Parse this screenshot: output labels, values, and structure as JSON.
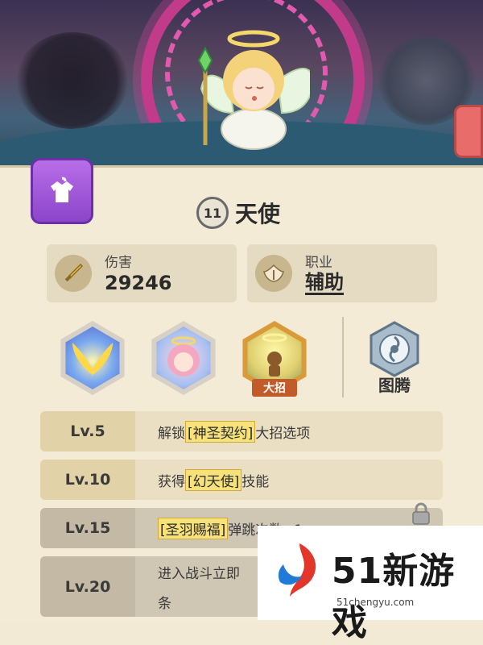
{
  "hero": {
    "level": "11",
    "name": "天使"
  },
  "stats": {
    "damage_label": "伤害",
    "damage_value": "29246",
    "class_label": "职业",
    "class_value": "辅助"
  },
  "skills": {
    "ultimate_tag": "大招",
    "totem_label": "图腾"
  },
  "level_rewards": [
    {
      "level": "Lv.5",
      "prefix": "解锁",
      "highlight": "[神圣契约]",
      "suffix": "大招选项",
      "locked": false
    },
    {
      "level": "Lv.10",
      "prefix": "获得",
      "highlight": "[幻天使]",
      "suffix": "技能",
      "locked": false
    },
    {
      "level": "Lv.15",
      "prefix": "",
      "highlight": "[圣羽赐福]",
      "suffix": "弹跳次数+1",
      "locked": true
    },
    {
      "level": "Lv.20",
      "prefix": "进入战斗立即",
      "highlight": "",
      "suffix": "",
      "line2": "条",
      "locked": true
    }
  ],
  "watermark": {
    "brand": "51新游戏",
    "url": "51chengyu.com"
  },
  "colors": {
    "banner_ring": "#c23a8a",
    "panel_bg": "#f4ebd7",
    "ultimate_tag": "#c15b2a",
    "outfit_button": "#9a55d6"
  }
}
